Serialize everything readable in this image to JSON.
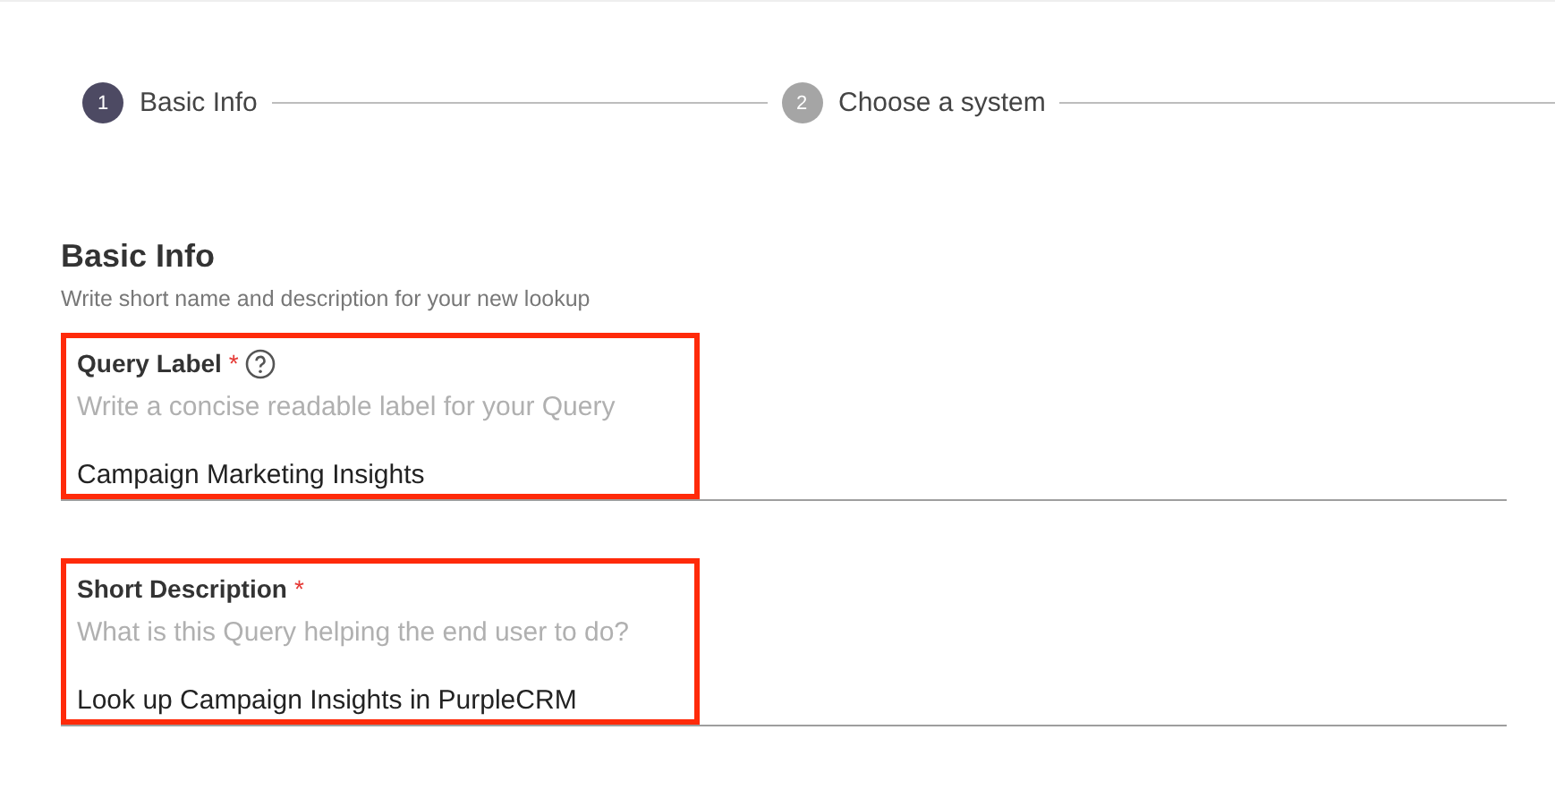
{
  "steps": [
    {
      "number": "1",
      "label": "Basic Info",
      "selected": true
    },
    {
      "number": "2",
      "label": "Choose a system",
      "selected": false
    }
  ],
  "section": {
    "title": "Basic Info",
    "subtitle": "Write short name and description for your new lookup"
  },
  "fields": [
    {
      "label": "Query Label",
      "required_mark": "*",
      "help_icon": true,
      "hint": "Write a concise readable label for your Query",
      "value": "Campaign Marketing Insights",
      "highlighted": true
    },
    {
      "label": "Short Description",
      "required_mark": "*",
      "help_icon": false,
      "hint": "What is this Query helping the end user to do?",
      "value": "Look up Campaign Insights in PurpleCRM",
      "highlighted": true
    }
  ]
}
